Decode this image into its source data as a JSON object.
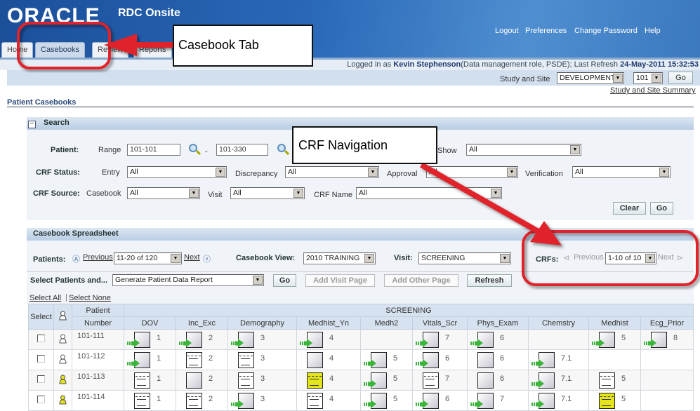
{
  "header": {
    "logo": "ORACLE",
    "app_name": "RDC Onsite",
    "links": [
      "Logout",
      "Preferences",
      "Change Password",
      "Help"
    ]
  },
  "tabs": [
    "Home",
    "Casebooks",
    "Review",
    "Reports"
  ],
  "active_tab": "Casebooks",
  "login": {
    "prefix": "Logged in as ",
    "user": "Kevin Stephenson",
    "role": "(Data management role, PSDE); Last Refresh ",
    "time": "24-May-2011 15:32:53"
  },
  "study_site": {
    "label": "Study and Site",
    "study": "DEVELOPMENT",
    "site": "101",
    "go": "Go",
    "summary_link": "Study and Site Summary"
  },
  "page_title": "Patient Casebooks",
  "search": {
    "title": "Search",
    "patient_label": "Patient:",
    "range_label": "Range",
    "range_from": "101-101",
    "range_to": "101-330",
    "dash": "-",
    "show_label": "Show",
    "show": "All",
    "crf_status_label": "CRF Status:",
    "entry_label": "Entry",
    "entry": "All",
    "discrepancy_label": "Discrepancy",
    "discrepancy": "All",
    "approval_label": "Approval",
    "approval": "All",
    "verification_label": "Verification",
    "verification": "All",
    "crf_source_label": "CRF Source:",
    "casebook_label": "Casebook",
    "casebook": "All",
    "visit_label": "Visit",
    "visit": "All",
    "crf_name_label": "CRF Name",
    "crf_name": "All",
    "clear": "Clear",
    "go": "Go"
  },
  "spreadsheet": {
    "title": "Casebook Spreadsheet",
    "patients_label": "Patients:",
    "previous": "Previous",
    "patients_range": "11-20 of 120",
    "next": "Next",
    "view_label": "Casebook View:",
    "view": "2010 TRAINING",
    "visit_label": "Visit:",
    "visit": "SCREENING",
    "crfs_label": "CRFs:",
    "crfs_previous": "Previous",
    "crfs_range": "1-10 of 10",
    "crfs_next": "Next",
    "select_patients_label": "Select Patients and...",
    "action": "Generate Patient Data Report",
    "go": "Go",
    "add_visit": "Add Visit Page",
    "add_other": "Add Other Page",
    "refresh": "Refresh",
    "select_all": "Select All",
    "select_none": "Select None"
  },
  "table": {
    "select_header": "Select",
    "patient_header": "Patient",
    "number_header": "Number",
    "visit_header": "SCREENING",
    "crfs": [
      "DOV",
      "Inc_Exc",
      "Demography",
      "Medhist_Yn",
      "Medh2",
      "Vitals_Scr",
      "Phys_Exam",
      "Chemstry",
      "Medhist",
      "Ecg_Prior"
    ],
    "rows": [
      {
        "patient": "101-111",
        "status": "white",
        "cells": [
          [
            "new",
            "1"
          ],
          [
            "new",
            "2"
          ],
          [
            "new",
            "3"
          ],
          [
            "new",
            "4"
          ],
          null,
          [
            "new",
            "7"
          ],
          [
            "new",
            "6"
          ],
          null,
          [
            "new",
            "5"
          ],
          [
            "new",
            "8"
          ]
        ]
      },
      {
        "patient": "101-112",
        "status": "white",
        "cells": [
          [
            "new",
            "1"
          ],
          [
            "entered",
            "2"
          ],
          [
            "entered",
            "3"
          ],
          [
            "blank",
            "4"
          ],
          [
            "new",
            "5"
          ],
          [
            "new",
            "6"
          ],
          [
            "blank",
            "6"
          ],
          [
            "new",
            "7.1"
          ],
          null,
          null
        ]
      },
      {
        "patient": "101-113",
        "status": "yellow",
        "cells": [
          [
            "entered",
            "1"
          ],
          [
            "blank",
            "2"
          ],
          [
            "entered",
            "3"
          ],
          [
            "yellow",
            "4"
          ],
          [
            "new",
            "5"
          ],
          [
            "entered",
            "7"
          ],
          [
            "blank",
            "6"
          ],
          [
            "new",
            "7.1"
          ],
          [
            "entered",
            "5"
          ],
          null
        ]
      },
      {
        "patient": "101-114",
        "status": "yellow",
        "cells": [
          [
            "entered",
            "1"
          ],
          [
            "entered",
            "2"
          ],
          [
            "new",
            "3"
          ],
          [
            "entered",
            "4"
          ],
          [
            "new",
            "5"
          ],
          [
            "new",
            "6"
          ],
          [
            "new",
            "7"
          ],
          [
            "new",
            "7.1"
          ],
          [
            "yellow",
            "5"
          ],
          null
        ]
      }
    ]
  },
  "annotations": {
    "casebook_tab": "Casebook Tab",
    "crf_navigation": "CRF Navigation"
  },
  "colors": {
    "header_blue": "#2a69b8",
    "annotation_red": "#e0202a",
    "new_arrow_green": "#3cb43c",
    "discrepancy_yellow": "#e4e41a"
  }
}
